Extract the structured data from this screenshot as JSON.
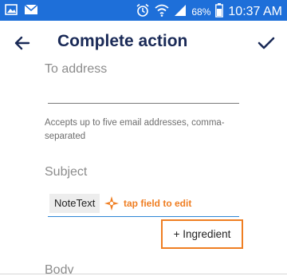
{
  "status_bar": {
    "battery": "68%",
    "time": "10:37 AM",
    "icons": [
      "image-icon",
      "mail-icon",
      "alarm-icon",
      "wifi-icon",
      "signal-icon",
      "battery-icon"
    ]
  },
  "app_bar": {
    "title": "Complete action",
    "back_icon": "arrow-left-icon",
    "done_icon": "check-icon"
  },
  "form": {
    "to_address": {
      "label": "To address",
      "value": "",
      "help": "Accepts up to five email addresses, comma-separated"
    },
    "subject": {
      "label": "Subject",
      "chip": "NoteText",
      "hint": "tap field to edit"
    },
    "ingredient_button": "+ Ingredient",
    "body": {
      "label": "Body"
    }
  },
  "colors": {
    "status_bar": "#1e6fd9",
    "title": "#1a2a57",
    "accent_orange": "#ef7e22",
    "field_active": "#2f86d6"
  }
}
